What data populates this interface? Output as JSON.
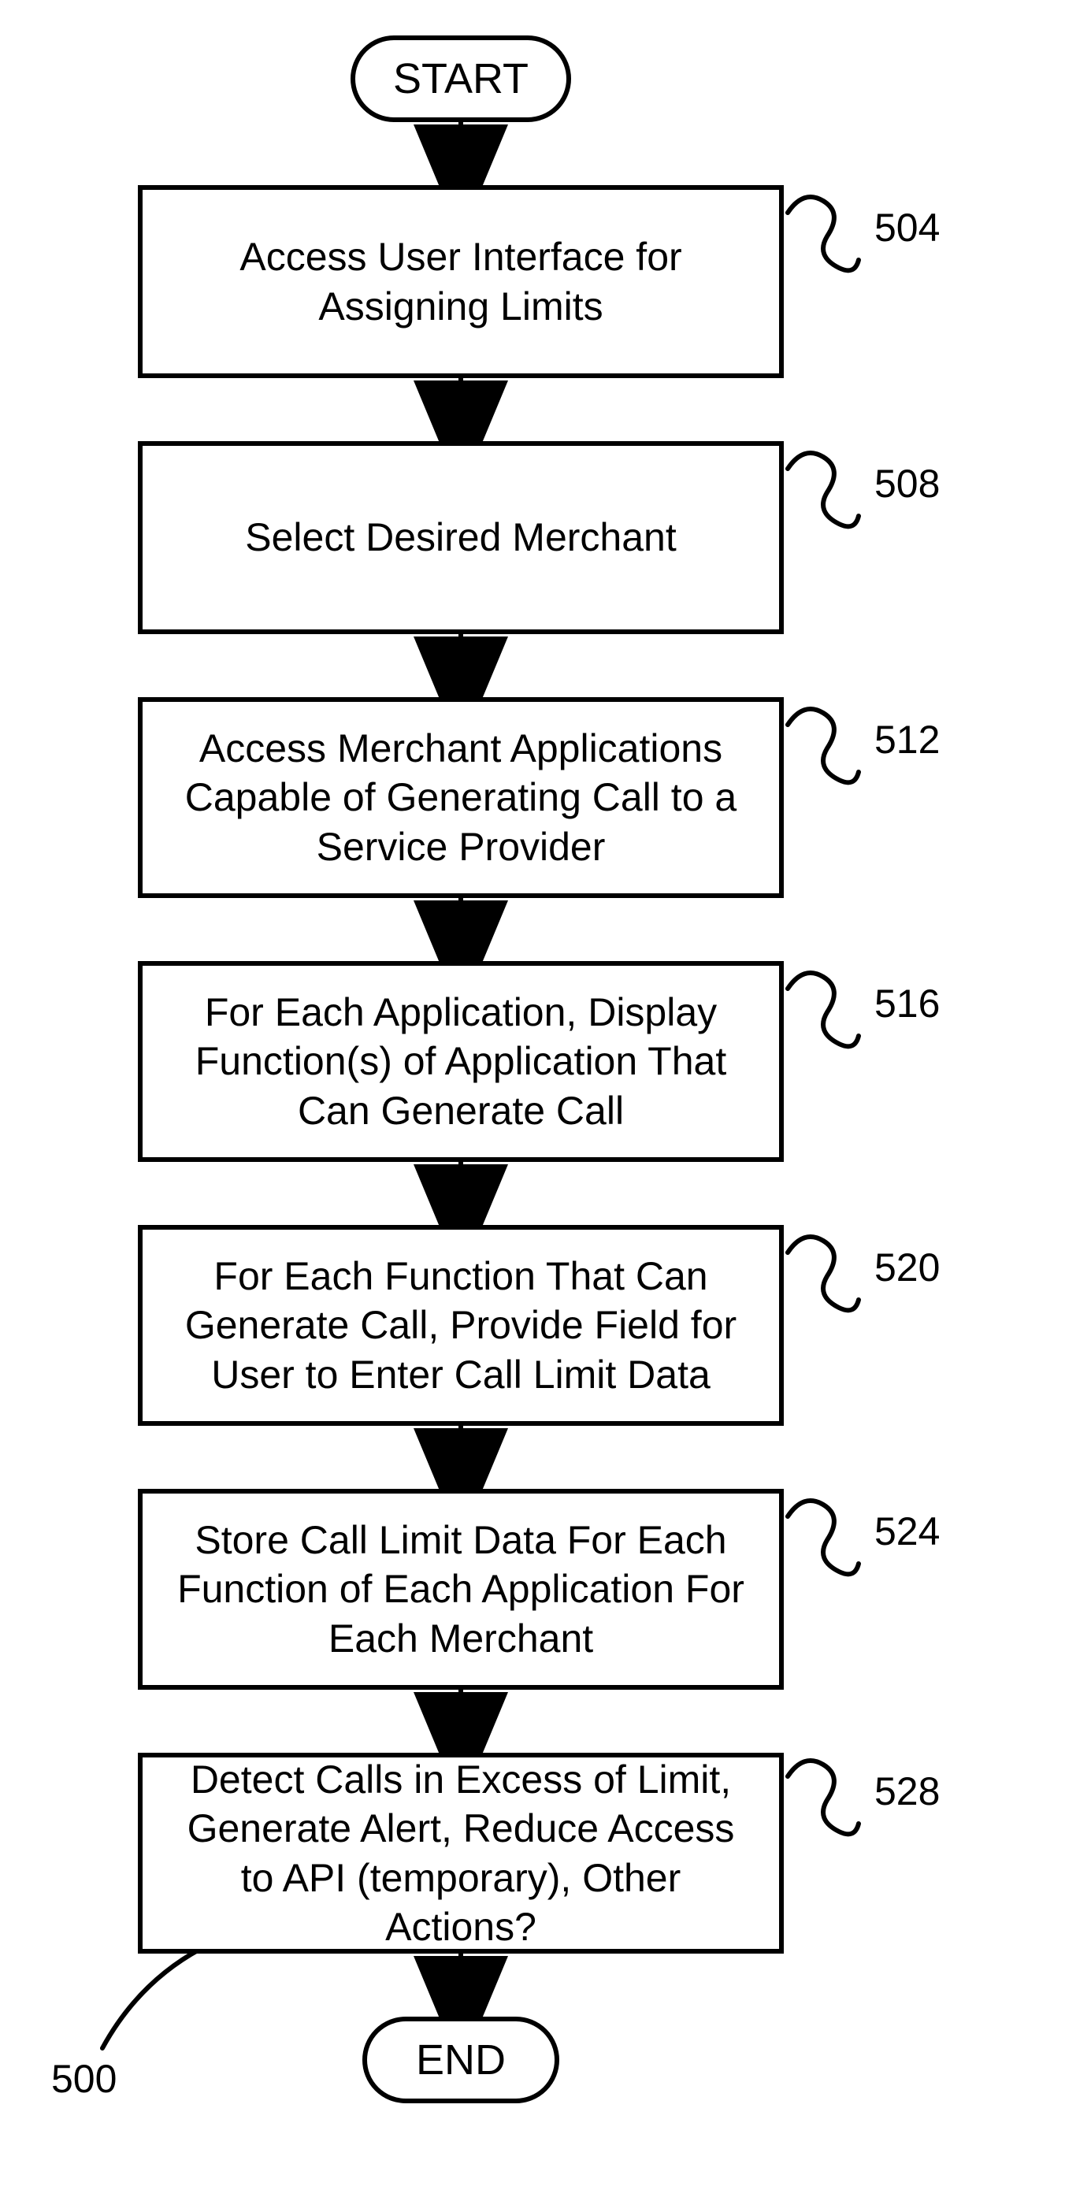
{
  "terminators": {
    "start": "START",
    "end": "END"
  },
  "steps": {
    "s504": "Access User Interface for Assigning Limits",
    "s508": "Select Desired Merchant",
    "s512": "Access Merchant Applications Capable of Generating Call to a Service Provider",
    "s516": "For Each Application, Display Function(s) of Application That Can Generate Call",
    "s520": "For Each Function That Can Generate Call, Provide Field for User to Enter Call Limit Data",
    "s524": "Store Call Limit Data For Each Function of Each Application For Each Merchant",
    "s528": "Detect Calls in Excess of Limit, Generate Alert, Reduce Access to API (temporary), Other Actions?"
  },
  "refs": {
    "r504": "504",
    "r508": "508",
    "r512": "512",
    "r516": "516",
    "r520": "520",
    "r524": "524",
    "r528": "528",
    "fig": "500"
  }
}
